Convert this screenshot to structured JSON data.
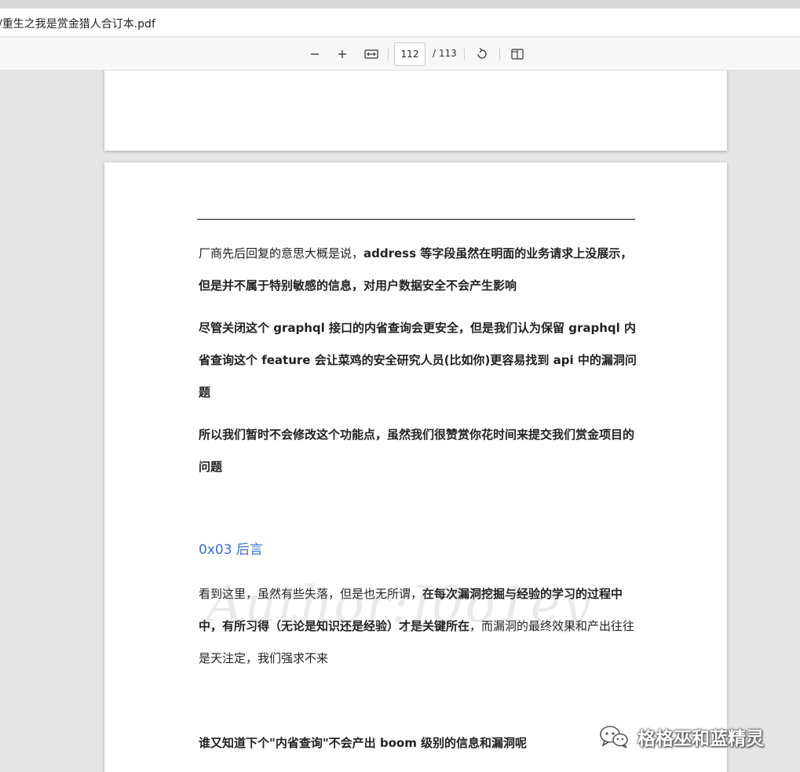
{
  "window": {
    "title": "/重生之我是赏金猎人合订本.pdf"
  },
  "toolbar": {
    "zoom_out_icon": "minus-icon",
    "zoom_in_icon": "plus-icon",
    "fit_icon": "fit-width-icon",
    "page_current": "112",
    "page_total": "/ 113",
    "rotate_icon": "rotate-icon",
    "two_page_icon": "two-page-view-icon"
  },
  "doc": {
    "p1_a": "厂商先后回复的意思大概是说，",
    "p1_b": "address 等字段虽然在明面的业务请求上没展示，但是并不属于特别敏感的信息，对用户数据安全不会产生影响",
    "p2": "尽管关闭这个 graphql 接口的内省查询会更安全，但是我们认为保留 graphql 内省查询这个 feature 会让菜鸡的安全研究人员(比如你)更容易找到 api 中的漏洞问题",
    "p3": "所以我们暂时不会修改这个功能点，虽然我们很赞赏你花时间来提交我们赏金项目的问题",
    "heading": "0x03  后言",
    "p4_a": "看到这里，虽然有些失落，但是也无所谓，",
    "p4_b": "在每次漏洞挖掘与经验的学习的过程中中，有所习得（无论是知识还是经验）才是关键所在",
    "p4_c": "，而漏洞的最终效果和产出往往是天注定，我们强求不来",
    "p5": "谁又知道下个\"内省查询\"不会产出 boom 级别的信息和漏洞呢",
    "watermark": "Author:J0o1ey"
  },
  "badge": {
    "icon": "wechat-icon",
    "text": "格格巫和蓝精灵"
  },
  "colors": {
    "heading": "#3b6fd0",
    "viewer_bg": "#e6e6e6"
  }
}
